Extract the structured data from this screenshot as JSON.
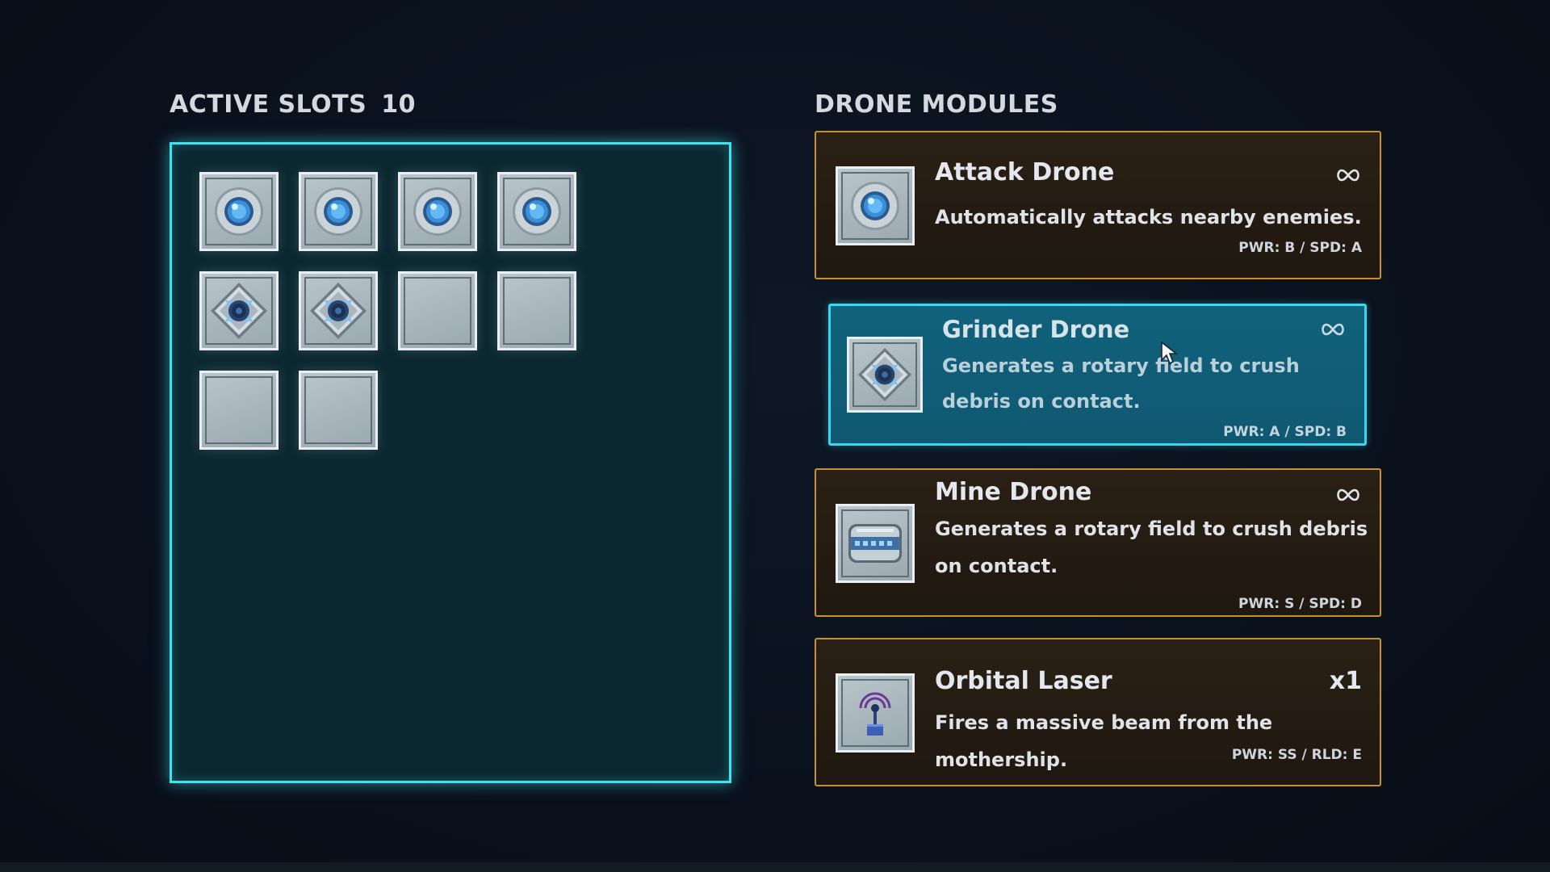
{
  "active_slots": {
    "label": "ACTIVE SLOTS",
    "count": "10",
    "slots": [
      {
        "content": "attack-drone"
      },
      {
        "content": "attack-drone"
      },
      {
        "content": "attack-drone"
      },
      {
        "content": "attack-drone"
      },
      {
        "content": "grinder-drone"
      },
      {
        "content": "grinder-drone"
      },
      {
        "content": "empty"
      },
      {
        "content": "empty"
      },
      {
        "content": "empty"
      },
      {
        "content": "empty"
      }
    ]
  },
  "drone_modules": {
    "label": "DRONE MODULES",
    "items": [
      {
        "name": "Attack Drone",
        "icon": "attack-drone-icon",
        "description": "Automatically attacks nearby enemies.",
        "stats": "PWR: B / SPD: A",
        "quantity": "infinite",
        "selected": false
      },
      {
        "name": "Grinder Drone",
        "icon": "grinder-drone-icon",
        "description": "Generates a rotary field to crush debris on contact.",
        "stats": "PWR: A / SPD: B",
        "quantity": "infinite",
        "selected": true
      },
      {
        "name": "Mine Drone",
        "icon": "mine-drone-icon",
        "description": "Generates a rotary field to crush debris on contact.",
        "stats": "PWR: S / SPD: D",
        "quantity": "infinite",
        "selected": false
      },
      {
        "name": "Orbital Laser",
        "icon": "orbital-laser-icon",
        "description": "Fires a massive beam from the mothership.",
        "stats": "PWR: SS / RLD: E",
        "quantity": "x1",
        "selected": false
      }
    ]
  },
  "colors": {
    "panel_border": "#3fe3ee",
    "card_border": "#c8912e",
    "selected_card": "#11627c",
    "background": "#0a1220"
  }
}
